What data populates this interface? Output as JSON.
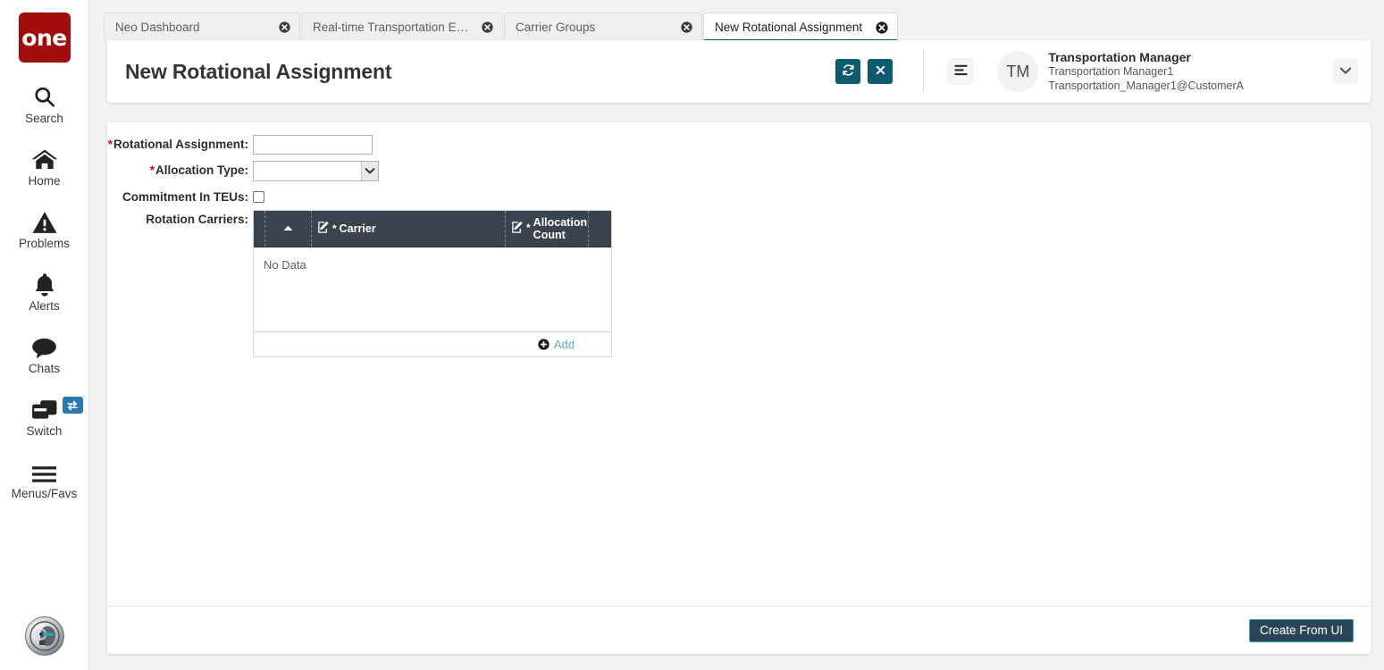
{
  "brand": {
    "logo_text": "one"
  },
  "sidebar": {
    "items": [
      {
        "label": "Search",
        "icon": "search-icon"
      },
      {
        "label": "Home",
        "icon": "home-icon"
      },
      {
        "label": "Problems",
        "icon": "warning-triangle-icon"
      },
      {
        "label": "Alerts",
        "icon": "bell-icon"
      },
      {
        "label": "Chats",
        "icon": "chat-bubble-icon"
      },
      {
        "label": "Switch",
        "icon": "windows-stack-icon",
        "badge_icon": "swap-arrows-icon"
      },
      {
        "label": "Menus/Favs",
        "icon": "hamburger-icon"
      }
    ],
    "assistant": {
      "icon": "ai-assistant-avatar"
    }
  },
  "tabs": [
    {
      "label": "Neo Dashboard",
      "active": false
    },
    {
      "label": "Real-time Transportation Executi...",
      "active": false
    },
    {
      "label": "Carrier Groups",
      "active": false
    },
    {
      "label": "New Rotational Assignment",
      "active": true
    }
  ],
  "header": {
    "title": "New Rotational Assignment",
    "refresh_icon": "refresh-icon",
    "close_icon": "close-x-icon",
    "menu_icon": "hamburger-menu-icon",
    "avatar_initials": "TM",
    "user_name": "Transportation Manager",
    "user_login": "Transportation Manager1",
    "user_email": "Transportation_Manager1@CustomerA",
    "caret_icon": "chevron-down-icon"
  },
  "form": {
    "fields": {
      "rotational_assignment": {
        "label": "Rotational Assignment:",
        "required": true,
        "value": "",
        "placeholder": ""
      },
      "allocation_type": {
        "label": "Allocation Type:",
        "required": true,
        "selected": "",
        "options": []
      },
      "commitment_in_teus": {
        "label": "Commitment In TEUs:",
        "required": false,
        "checked": false
      },
      "rotation_carriers": {
        "label": "Rotation Carriers:"
      }
    }
  },
  "grid": {
    "columns": [
      {
        "key": "sort",
        "label": "",
        "sort_icon": "sort-asc-arrow-icon",
        "editable": false,
        "required": false
      },
      {
        "key": "carrier",
        "label": "Carrier",
        "edit_icon": "edit-pencil-icon",
        "editable": true,
        "required": true
      },
      {
        "key": "alloc",
        "label": "Allocation Count",
        "edit_icon": "edit-pencil-icon",
        "editable": true,
        "required": true
      }
    ],
    "rows": [],
    "empty_message": "No Data",
    "add_label": "Add",
    "add_icon": "plus-circle-icon"
  },
  "footer": {
    "create_label": "Create From UI"
  },
  "colors": {
    "brand_red": "#a20d0d",
    "teal": "#0d5c6e",
    "grid_header": "#3b434e",
    "link_teal": "#5bacbf",
    "required_red": "#d0021b",
    "button_navy": "#2b4558",
    "button_border_teal": "#3e9fae",
    "badge_blue": "#2a7ab0"
  }
}
